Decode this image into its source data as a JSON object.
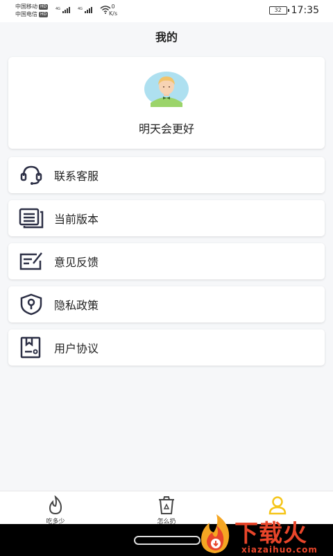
{
  "status_bar": {
    "carrier1": "中国移动",
    "carrier2": "中国电信",
    "hd_badge": "HD",
    "net_type": "4G",
    "speed_value": "0",
    "speed_unit": "K/s",
    "battery": "32",
    "time": "17:35"
  },
  "page_title": "我的",
  "profile": {
    "username": "明天会更好",
    "avatar_icon": "avatar-icon"
  },
  "menu": [
    {
      "label": "联系客服",
      "icon": "headset-icon"
    },
    {
      "label": "当前版本",
      "icon": "document-stack-icon"
    },
    {
      "label": "意见反馈",
      "icon": "feedback-edit-icon"
    },
    {
      "label": "隐私政策",
      "icon": "shield-keyhole-icon"
    },
    {
      "label": "用户协议",
      "icon": "agreement-icon"
    }
  ],
  "bottom_nav": [
    {
      "label": "吃多少",
      "icon": "flame-icon",
      "active": false
    },
    {
      "label": "怎么扔",
      "icon": "recycle-bin-icon",
      "active": false
    },
    {
      "label": "",
      "icon": "user-icon",
      "active": true
    }
  ],
  "colors": {
    "accent": "#f5c518",
    "icon_dark": "#2c2f45",
    "watermark": "#e8452a"
  },
  "watermark": {
    "text": "下载火",
    "sub": "xiazaihuo.com"
  }
}
